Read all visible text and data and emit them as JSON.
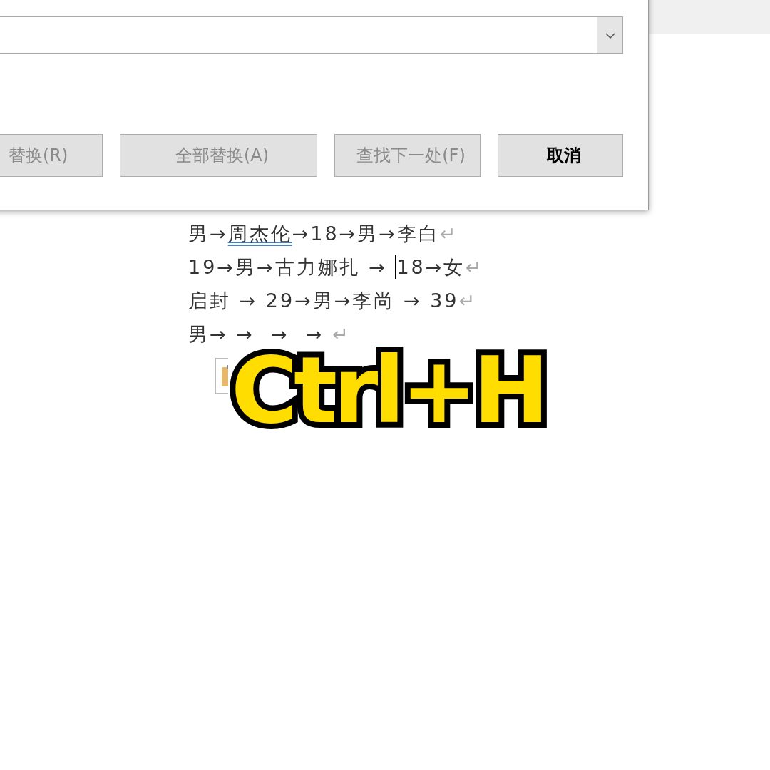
{
  "dialog": {
    "buttons": [
      {
        "label": "替换(R)",
        "disabled": true
      },
      {
        "label": "全部替换(A)",
        "disabled": true
      },
      {
        "label": "查找下一处(F)",
        "disabled": true
      },
      {
        "label": "取消",
        "disabled": false
      }
    ]
  },
  "document": {
    "lines": [
      {
        "segments": [
          {
            "kind": "text",
            "text": "男→"
          },
          {
            "kind": "underlined",
            "text": "周杰伦"
          },
          {
            "kind": "text",
            "text": "→18→男→李白"
          },
          {
            "kind": "mark",
            "text": "↵"
          }
        ]
      },
      {
        "segments": [
          {
            "kind": "text",
            "text": "19→男→古力娜扎 → "
          },
          {
            "kind": "caret"
          },
          {
            "kind": "text",
            "text": "18→女"
          },
          {
            "kind": "mark",
            "text": "↵"
          }
        ]
      },
      {
        "segments": [
          {
            "kind": "text",
            "text": "启封 → 29→男→李尚 → 39"
          },
          {
            "kind": "mark",
            "text": "↵"
          }
        ]
      },
      {
        "segments": [
          {
            "kind": "text",
            "text": "男→ →  →  → "
          },
          {
            "kind": "mark",
            "text": "↵"
          }
        ]
      }
    ]
  },
  "caption": "Ctrl+H"
}
